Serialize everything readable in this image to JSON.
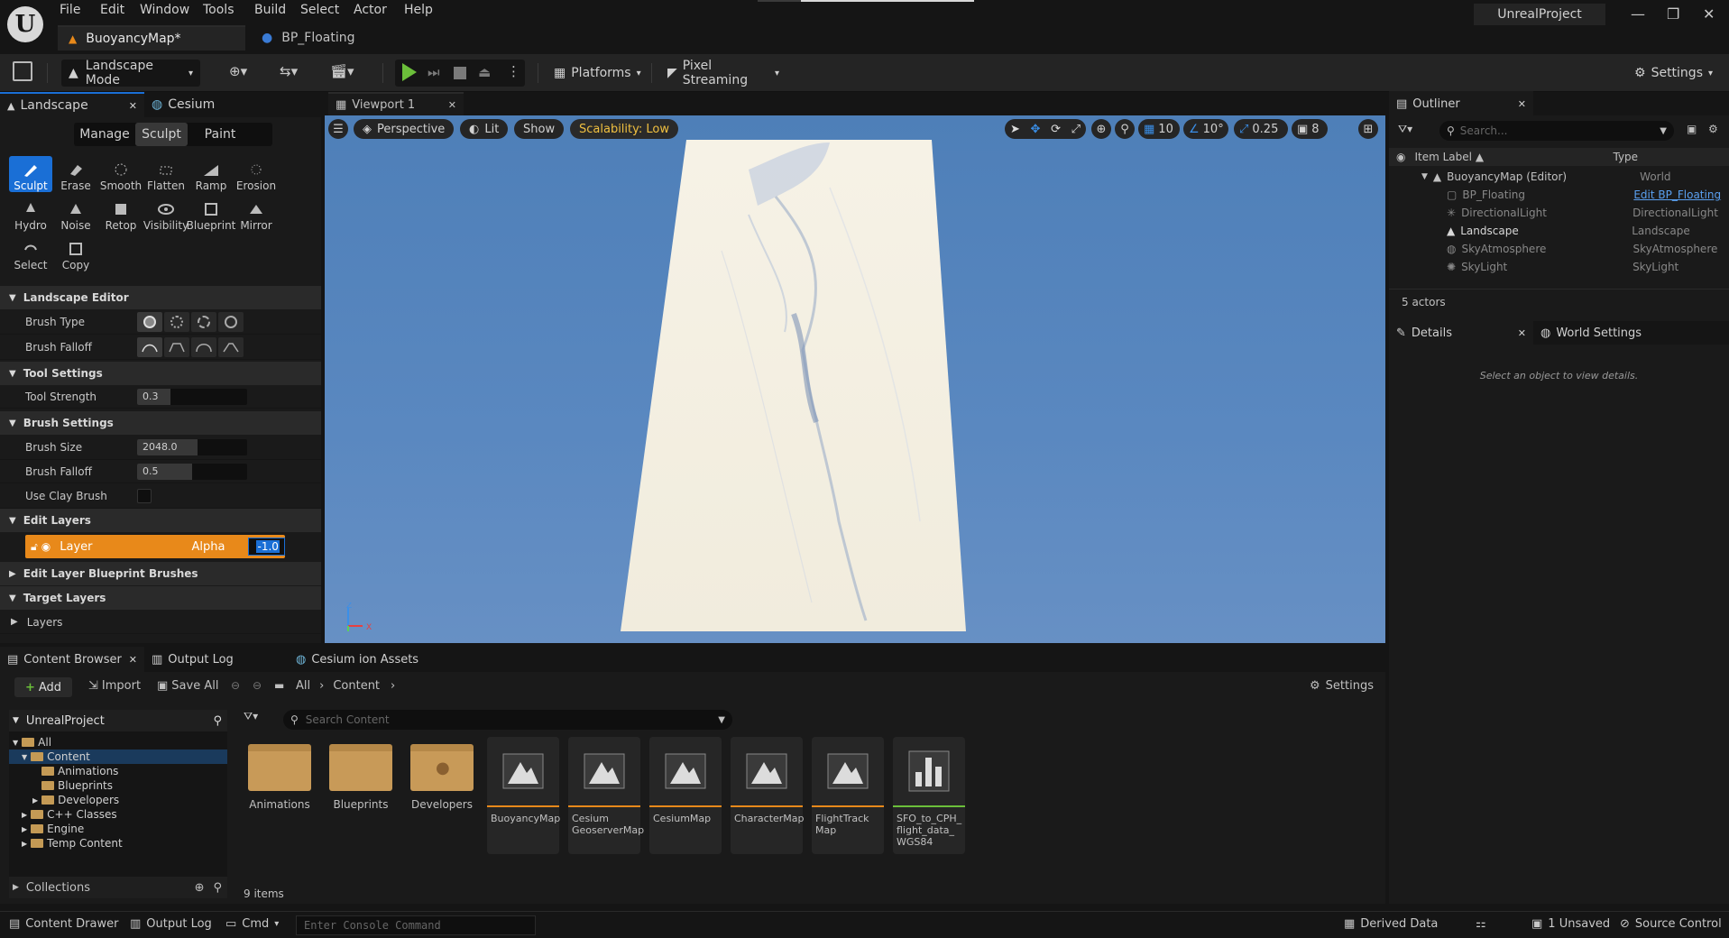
{
  "menu": [
    "File",
    "Edit",
    "Window",
    "Tools",
    "Build",
    "Select",
    "Actor",
    "Help"
  ],
  "doc_tabs": {
    "active": "BuoyancyMap*",
    "second": "BP_Floating"
  },
  "project_name": "UnrealProject",
  "toolbar": {
    "mode": "Landscape Mode",
    "platforms": "Platforms",
    "pixel_streaming": "Pixel Streaming",
    "settings": "Settings"
  },
  "left_panel": {
    "tabs": [
      "Landscape",
      "Cesium"
    ],
    "modes": [
      "Manage",
      "Sculpt",
      "Paint"
    ],
    "tools": [
      "Sculpt",
      "Erase",
      "Smooth",
      "Flatten",
      "Ramp",
      "Erosion",
      "Hydro",
      "Noise",
      "Retop",
      "Visibility",
      "Blueprint",
      "Mirror",
      "Select",
      "Copy"
    ],
    "sections": {
      "landscape_editor": "Landscape Editor",
      "tool_settings": "Tool Settings",
      "brush_settings": "Brush Settings",
      "edit_layers": "Edit Layers",
      "edit_layer_bp": "Edit Layer Blueprint Brushes",
      "target_layers": "Target Layers"
    },
    "props": {
      "brush_type": "Brush Type",
      "brush_falloff_type": "Brush Falloff",
      "tool_strength_label": "Tool Strength",
      "tool_strength": "0.3",
      "brush_size_label": "Brush Size",
      "brush_size": "2048.0",
      "brush_falloff_label": "Brush Falloff",
      "brush_falloff": "0.5",
      "use_clay_label": "Use Clay Brush",
      "layers_label": "Layers"
    },
    "layer_row": {
      "name": "Layer",
      "alpha_label": "Alpha",
      "alpha_value": "-1.0"
    }
  },
  "viewport": {
    "tab": "Viewport 1",
    "perspective": "Perspective",
    "lit": "Lit",
    "show": "Show",
    "scalability": "Scalability: Low",
    "grid": "10",
    "angle": "10°",
    "scale": "0.25",
    "camera": "8"
  },
  "outliner": {
    "title": "Outliner",
    "search_placeholder": "Search...",
    "col_label": "Item Label",
    "col_type": "Type",
    "root": {
      "label": "BuoyancyMap (Editor)",
      "type": "World"
    },
    "items": [
      {
        "label": "BP_Floating",
        "type": "Edit BP_Floating"
      },
      {
        "label": "DirectionalLight",
        "type": "DirectionalLight"
      },
      {
        "label": "Landscape",
        "type": "Landscape"
      },
      {
        "label": "SkyAtmosphere",
        "type": "SkyAtmosphere"
      },
      {
        "label": "SkyLight",
        "type": "SkyLight"
      }
    ],
    "count": "5 actors"
  },
  "details": {
    "tab": "Details",
    "world_settings": "World Settings",
    "empty_msg": "Select an object to view details."
  },
  "content_browser": {
    "tabs": [
      "Content Browser",
      "Output Log",
      "Cesium ion Assets"
    ],
    "add": "Add",
    "import": "Import",
    "save_all": "Save All",
    "path": [
      "All",
      "Content"
    ],
    "settings": "Settings",
    "project": "UnrealProject",
    "search_placeholder": "Search Content",
    "tree": [
      "All",
      "Content",
      "Animations",
      "Blueprints",
      "Developers",
      "C++ Classes",
      "Engine",
      "Temp Content"
    ],
    "collections": "Collections",
    "folders": [
      "Animations",
      "Blueprints",
      "Developers"
    ],
    "assets": [
      "BuoyancyMap",
      "Cesium GeoserverMap",
      "CesiumMap",
      "CharacterMap",
      "FlightTrack Map",
      "SFO_to_CPH_ flight_data_ WGS84"
    ],
    "item_count": "9 items"
  },
  "statusbar": {
    "content_drawer": "Content Drawer",
    "output_log": "Output Log",
    "cmd": "Cmd",
    "console_placeholder": "Enter Console Command",
    "derived_data": "Derived Data",
    "unsaved": "1 Unsaved",
    "source_control": "Source Control"
  },
  "colors": {
    "accent_orange": "#e8891a",
    "accent_blue": "#1a6fd6",
    "play_green": "#6bbf3a",
    "sky": "#5686bf",
    "landscape": "#f3efe2"
  }
}
